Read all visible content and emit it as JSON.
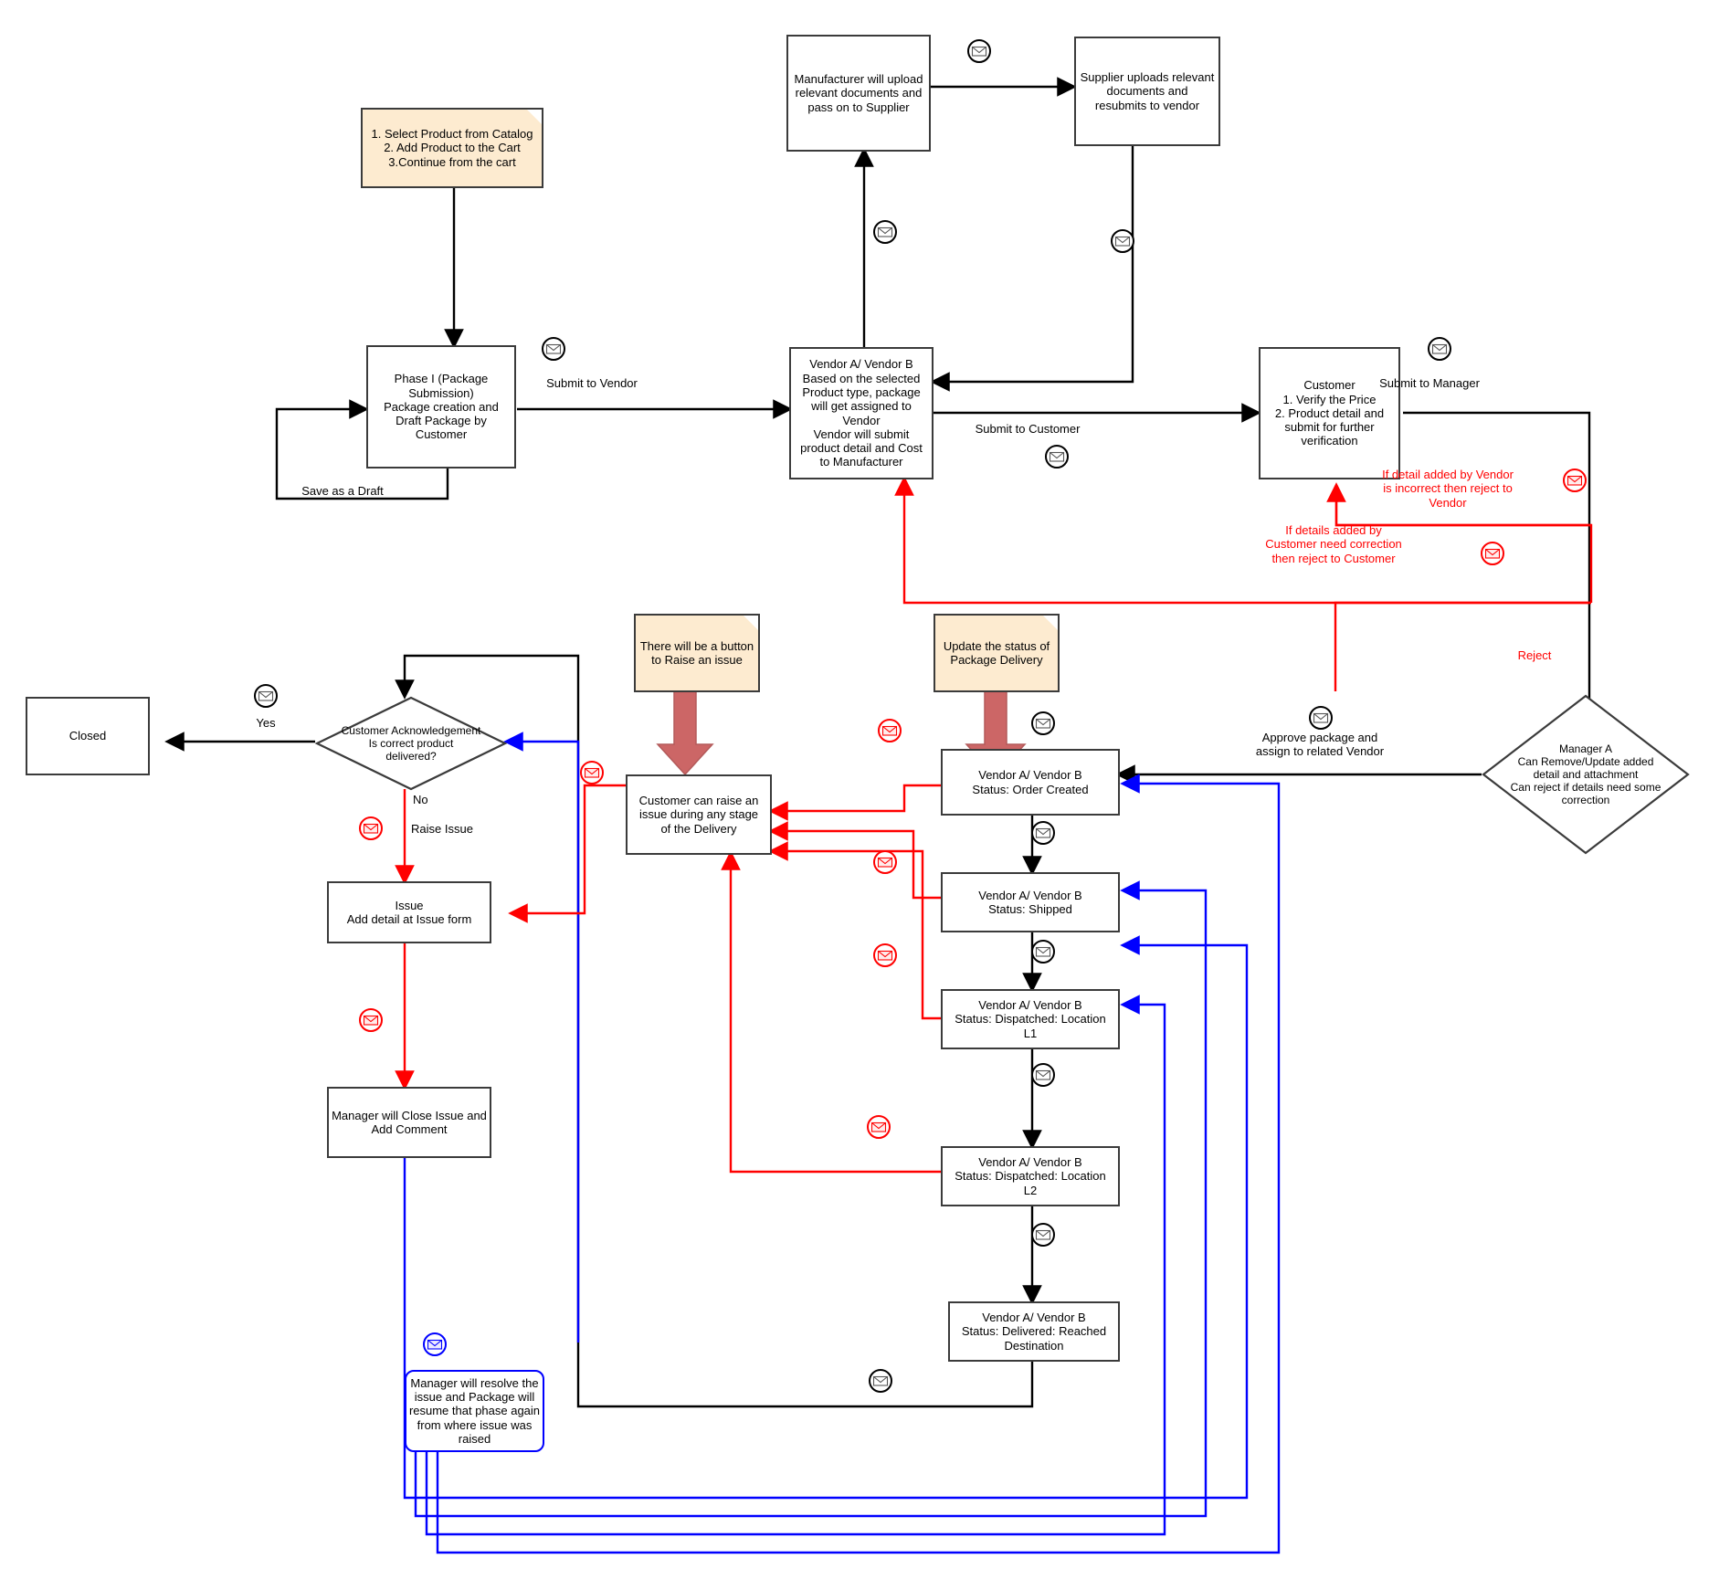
{
  "diagram": {
    "title": "Package Submission and Delivery Workflow",
    "colors": {
      "black": "#000000",
      "red": "#ff0000",
      "blue": "#0000ff",
      "note_fill": "#fdebd0",
      "node_stroke": "#3b3b3b",
      "thick_arrow": "#cc6666"
    }
  },
  "notes": [
    {
      "id": "note_catalog",
      "text": "1. Select Product from Catalog\n2. Add Product to the Cart\n3.Continue from the cart"
    },
    {
      "id": "note_raise",
      "text": "There will be a button\nto Raise an issue"
    },
    {
      "id": "note_update",
      "text": "Update the status of\nPackage Delivery"
    }
  ],
  "nodes": [
    {
      "id": "phase1",
      "text": "Phase I (Package\nSubmission)\nPackage creation and\nDraft Package by\nCustomer"
    },
    {
      "id": "manufacturer",
      "text": "Manufacturer will upload\nrelevant documents and\npass on to Supplier"
    },
    {
      "id": "supplier",
      "text": "Supplier uploads relevant\ndocuments and\nresubmits to vendor"
    },
    {
      "id": "vendor_assign",
      "text": "Vendor A/ Vendor B\nBased on the selected\nProduct type, package\nwill get assigned to\nVendor\nVendor will submit\nproduct detail and Cost\nto Manufacturer"
    },
    {
      "id": "customer_verify",
      "text": "Customer\n1. Verify the Price\n2. Product detail and\nsubmit for further\nverification"
    },
    {
      "id": "manager_a",
      "text": "Manager A\nCan Remove/Update added\ndetail and attachment\nCan reject if details need some\ncorrection"
    },
    {
      "id": "closed",
      "text": "Closed"
    },
    {
      "id": "cust_ack",
      "text": "Customer Acknowledgement\nIs correct product\ndelivered?"
    },
    {
      "id": "issue_form",
      "text": "Issue\nAdd detail at Issue form"
    },
    {
      "id": "manager_close",
      "text": "Manager will Close Issue and\nAdd Comment"
    },
    {
      "id": "manager_resolve",
      "text": "Manager will resolve the\nissue and Package will\nresume that phase again\nfrom where issue was\nraised"
    },
    {
      "id": "raise_issue_any",
      "text": "Customer can raise an\nissue during any stage\nof the Delivery"
    },
    {
      "id": "status_created",
      "text": "Vendor A/ Vendor B\nStatus: Order Created"
    },
    {
      "id": "status_shipped",
      "text": "Vendor A/ Vendor B\nStatus: Shipped"
    },
    {
      "id": "status_l1",
      "text": "Vendor A/ Vendor B\nStatus: Dispatched: Location\nL1"
    },
    {
      "id": "status_l2",
      "text": "Vendor A/ Vendor B\nStatus: Dispatched: Location\nL2"
    },
    {
      "id": "status_delivered",
      "text": "Vendor A/ Vendor B\nStatus: Delivered: Reached\nDestination"
    }
  ],
  "edge_labels": [
    {
      "id": "submit_vendor",
      "text": "Submit to Vendor",
      "color": "black"
    },
    {
      "id": "save_draft",
      "text": "Save as a Draft",
      "color": "black"
    },
    {
      "id": "submit_customer",
      "text": "Submit to Customer",
      "color": "black"
    },
    {
      "id": "submit_manager",
      "text": "Submit to Manager",
      "color": "black"
    },
    {
      "id": "reject_vendor",
      "text": "If detail added by Vendor\nis incorrect then reject to\nVendor",
      "color": "red"
    },
    {
      "id": "reject_customer",
      "text": "If details added by\nCustomer need correction\nthen reject to Customer",
      "color": "red"
    },
    {
      "id": "reject",
      "text": "Reject",
      "color": "red"
    },
    {
      "id": "approve_assign",
      "text": "Approve package and\nassign to related Vendor",
      "color": "black"
    },
    {
      "id": "yes",
      "text": "Yes",
      "color": "black"
    },
    {
      "id": "no",
      "text": "No",
      "color": "black"
    },
    {
      "id": "raise_issue",
      "text": "Raise Issue",
      "color": "black"
    }
  ],
  "envelopes": [
    {
      "id": "env-manufacturer-supplier",
      "name": "envelope-icon",
      "color": "black"
    },
    {
      "id": "env-vendor-manufacturer",
      "name": "envelope-icon",
      "color": "black"
    },
    {
      "id": "env-supplier-vendor",
      "name": "envelope-icon",
      "color": "black"
    },
    {
      "id": "env-submit-vendor",
      "name": "envelope-icon",
      "color": "black"
    },
    {
      "id": "env-submit-customer",
      "name": "envelope-icon",
      "color": "black"
    },
    {
      "id": "env-submit-manager",
      "name": "envelope-icon",
      "color": "black"
    },
    {
      "id": "env-reject-vendor",
      "name": "envelope-icon",
      "color": "red"
    },
    {
      "id": "env-reject-customer",
      "name": "envelope-icon",
      "color": "red"
    },
    {
      "id": "env-approve-assign",
      "name": "envelope-icon",
      "color": "black"
    },
    {
      "id": "env-yes",
      "name": "envelope-icon",
      "color": "black"
    },
    {
      "id": "env-raise-issue",
      "name": "envelope-icon",
      "color": "red"
    },
    {
      "id": "env-issue-manager",
      "name": "envelope-icon",
      "color": "red"
    },
    {
      "id": "env-resolve",
      "name": "envelope-icon",
      "color": "blue"
    },
    {
      "id": "env-issue-left",
      "name": "envelope-icon",
      "color": "red"
    },
    {
      "id": "env-created-issue",
      "name": "envelope-icon",
      "color": "red"
    },
    {
      "id": "env-shipped-issue",
      "name": "envelope-icon",
      "color": "red"
    },
    {
      "id": "env-l1-issue",
      "name": "envelope-icon",
      "color": "red"
    },
    {
      "id": "env-l2-issue",
      "name": "envelope-icon",
      "color": "red"
    },
    {
      "id": "env-created-top",
      "name": "envelope-icon",
      "color": "black"
    },
    {
      "id": "env-created-shipped",
      "name": "envelope-icon",
      "color": "black"
    },
    {
      "id": "env-shipped-l1",
      "name": "envelope-icon",
      "color": "black"
    },
    {
      "id": "env-l1-l2",
      "name": "envelope-icon",
      "color": "black"
    },
    {
      "id": "env-l2-delivered",
      "name": "envelope-icon",
      "color": "black"
    },
    {
      "id": "env-delivered-ack",
      "name": "envelope-icon",
      "color": "black"
    }
  ]
}
